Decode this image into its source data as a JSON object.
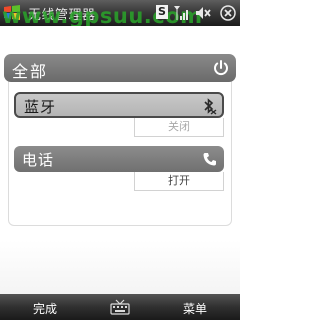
{
  "title_bar": {
    "app_title": "无线管理器",
    "watermark": "www.gpsuu.com",
    "tray_icons": [
      "start-icon",
      "s-badge-icon",
      "signal-icon",
      "volume-icon",
      "close-icon"
    ],
    "tray_s_label": "S"
  },
  "main": {
    "all": {
      "label": "全部",
      "icon": "power-icon"
    },
    "items": [
      {
        "label": "蓝牙",
        "status": "关闭",
        "icon": "bluetooth-icon",
        "selected": true
      },
      {
        "label": "电话",
        "status": "打开",
        "icon": "phone-icon",
        "selected": false
      }
    ]
  },
  "softkeys": {
    "left": "完成",
    "center_icon": "keyboard-icon",
    "right": "菜单"
  },
  "colors": {
    "watermark": "#2aa52a",
    "header_gray": "#7a7a7a",
    "selected_row": "#bebebe",
    "bar_dark": "#2a2a2a"
  }
}
